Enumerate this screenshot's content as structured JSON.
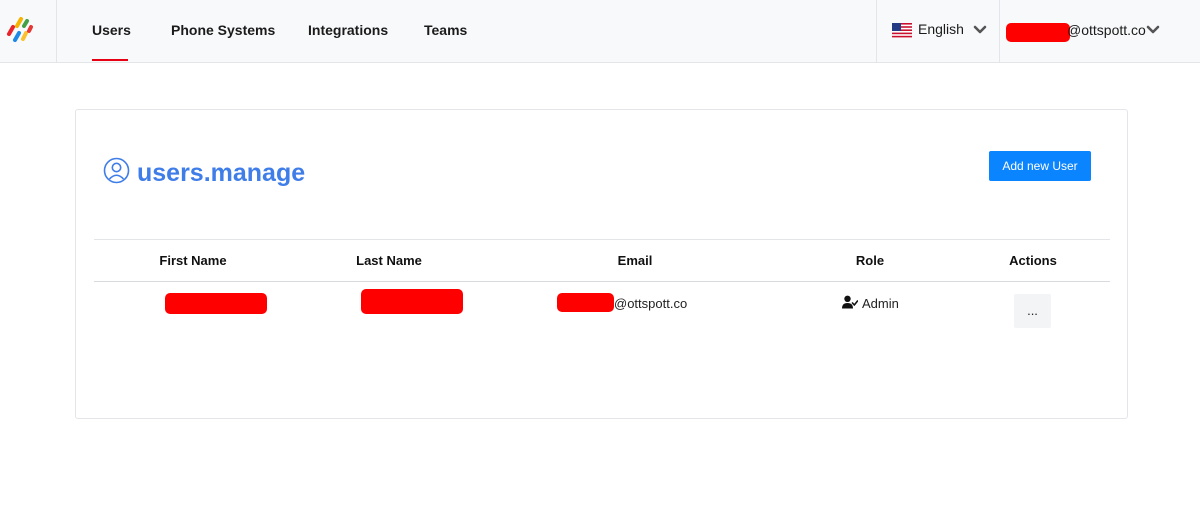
{
  "nav": {
    "tabs": [
      {
        "label": "Users",
        "active": true
      },
      {
        "label": "Phone Systems",
        "active": false
      },
      {
        "label": "Integrations",
        "active": false
      },
      {
        "label": "Teams",
        "active": false
      }
    ],
    "language": {
      "label": "English",
      "flag": "us-flag-icon"
    },
    "account": {
      "email_suffix": "@ottspott.co",
      "redacted": true
    }
  },
  "page": {
    "title": "users.manage",
    "title_icon": "user-circle-icon",
    "add_button_label": "Add new User"
  },
  "table": {
    "columns": [
      "First Name",
      "Last Name",
      "Email",
      "Role",
      "Actions"
    ],
    "rows": [
      {
        "first_name_redacted": true,
        "last_name_redacted": true,
        "email_suffix": "@ottspott.co",
        "role": "Admin",
        "role_icon": "user-check-icon",
        "actions_label": "..."
      }
    ]
  },
  "colors": {
    "accent": "#3f7de8",
    "button": "#0a84ff",
    "active_tab_underline": "#e60012",
    "redaction": "#ff0000"
  }
}
